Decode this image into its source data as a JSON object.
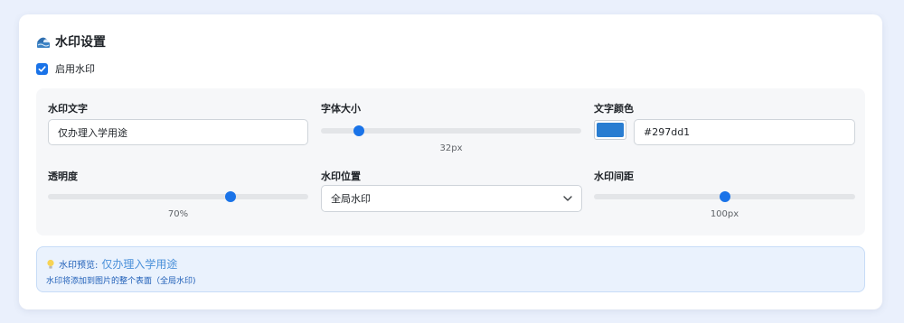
{
  "header": {
    "icon": "wave-emoji-icon",
    "title": "水印设置"
  },
  "enable": {
    "checked": true,
    "label": "启用水印"
  },
  "fields": {
    "text": {
      "label": "水印文字",
      "value": "仅办理入学用途"
    },
    "font_size": {
      "label": "字体大小",
      "value": 32,
      "min": 12,
      "max": 150,
      "display": "32px"
    },
    "color": {
      "label": "文字颜色",
      "value": "#297dd1",
      "swatch": "#297dd1"
    },
    "opacity": {
      "label": "透明度",
      "value": 70,
      "min": 0,
      "max": 100,
      "display": "70%"
    },
    "position": {
      "label": "水印位置",
      "selected": "全局水印"
    },
    "spacing": {
      "label": "水印间距",
      "value": 100,
      "min": 0,
      "max": 200,
      "display": "100px"
    }
  },
  "preview": {
    "icon": "lightbulb-icon",
    "label": "水印预览:",
    "value": "仅办理入学用途",
    "note": "水印将添加到图片的整个表面（全局水印)"
  },
  "colors": {
    "accent": "#1a73e8",
    "page_bg": "#eaf0fc",
    "preview_text": "#4a90d9"
  }
}
